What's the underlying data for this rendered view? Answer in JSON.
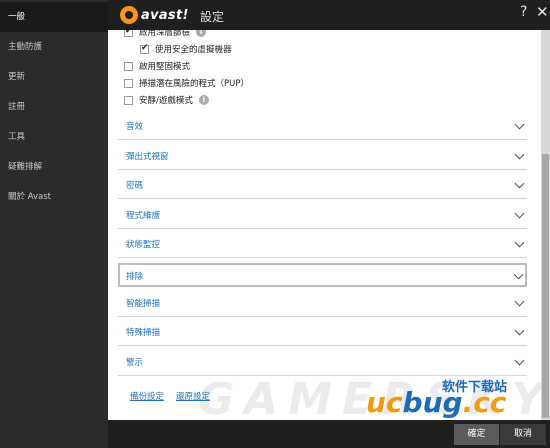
{
  "sidebar": {
    "items": [
      {
        "label": "一般",
        "active": true
      },
      {
        "label": "主動防護",
        "active": false
      },
      {
        "label": "更新",
        "active": false
      },
      {
        "label": "註冊",
        "active": false
      },
      {
        "label": "工具",
        "active": false
      },
      {
        "label": "疑難排解",
        "active": false
      },
      {
        "label": "關於 Avast",
        "active": false
      }
    ]
  },
  "titlebar": {
    "brand": "avast!",
    "title": "設定",
    "help_glyph": "?",
    "close_glyph": "✕"
  },
  "options": [
    {
      "label": "啟用深層篩檢",
      "checked": true,
      "info": true
    },
    {
      "label": "使用安全的虛擬機器",
      "checked": true,
      "info": false
    },
    {
      "label": "啟用堅固模式",
      "checked": false,
      "info": false
    },
    {
      "label": "掃描潛在風險的程式（PUP）",
      "checked": false,
      "info": false
    },
    {
      "label": "安靜/遊戲模式",
      "checked": false,
      "info": true
    }
  ],
  "info_glyph": "i",
  "sections": [
    {
      "label": "音效"
    },
    {
      "label": "彈出式視窗"
    },
    {
      "label": "密碼"
    },
    {
      "label": "程式維護"
    },
    {
      "label": "狀態監控"
    },
    {
      "label": "排除"
    },
    {
      "label": "智能掃描"
    },
    {
      "label": "特殊掃描"
    },
    {
      "label": "警示"
    }
  ],
  "links": {
    "backup": "備份設定",
    "restore": "還原設定"
  },
  "buttons": {
    "ok": "確定",
    "cancel": "取消"
  },
  "watermark": "GAMERSKY",
  "site_logo": {
    "cn": "软件下载站",
    "en_pre": "uc",
    "en_mid": "bug",
    "en_post": ".cc"
  },
  "colors": {
    "accent_orange": "#f7941d",
    "link_blue": "#1e73be",
    "sidebar_bg": "#2b2b2b",
    "titlebar_bg": "#1f1f1f"
  }
}
